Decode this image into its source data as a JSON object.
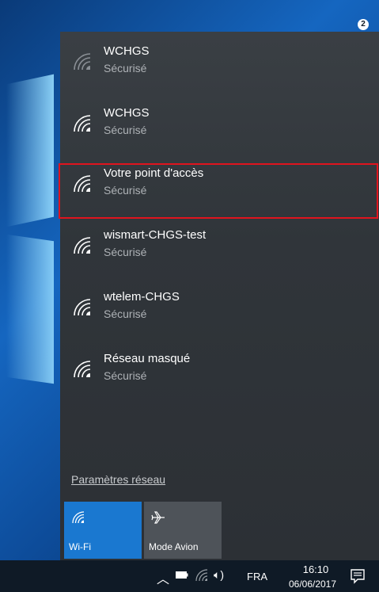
{
  "networks": [
    {
      "name": "WCHGS",
      "status": "Sécurisé"
    },
    {
      "name": "WCHGS",
      "status": "Sécurisé"
    },
    {
      "name": "Votre point d'accès",
      "status": "Sécurisé"
    },
    {
      "name": "wismart-CHGS-test",
      "status": "Sécurisé"
    },
    {
      "name": "wtelem-CHGS",
      "status": "Sécurisé"
    },
    {
      "name": "Réseau masqué",
      "status": "Sécurisé"
    }
  ],
  "settings_link": "Paramètres réseau",
  "tiles": {
    "wifi_label": "Wi-Fi",
    "airplane_label": "Mode Avion"
  },
  "taskbar": {
    "language": "FRA",
    "time": "16:10",
    "date": "06/06/2017",
    "notification_count": "2"
  },
  "colors": {
    "highlight": "#e0141e",
    "wifi_tile": "#1a78d0",
    "airplane_tile": "#4e5359",
    "flyout_bg": "#30353a"
  }
}
